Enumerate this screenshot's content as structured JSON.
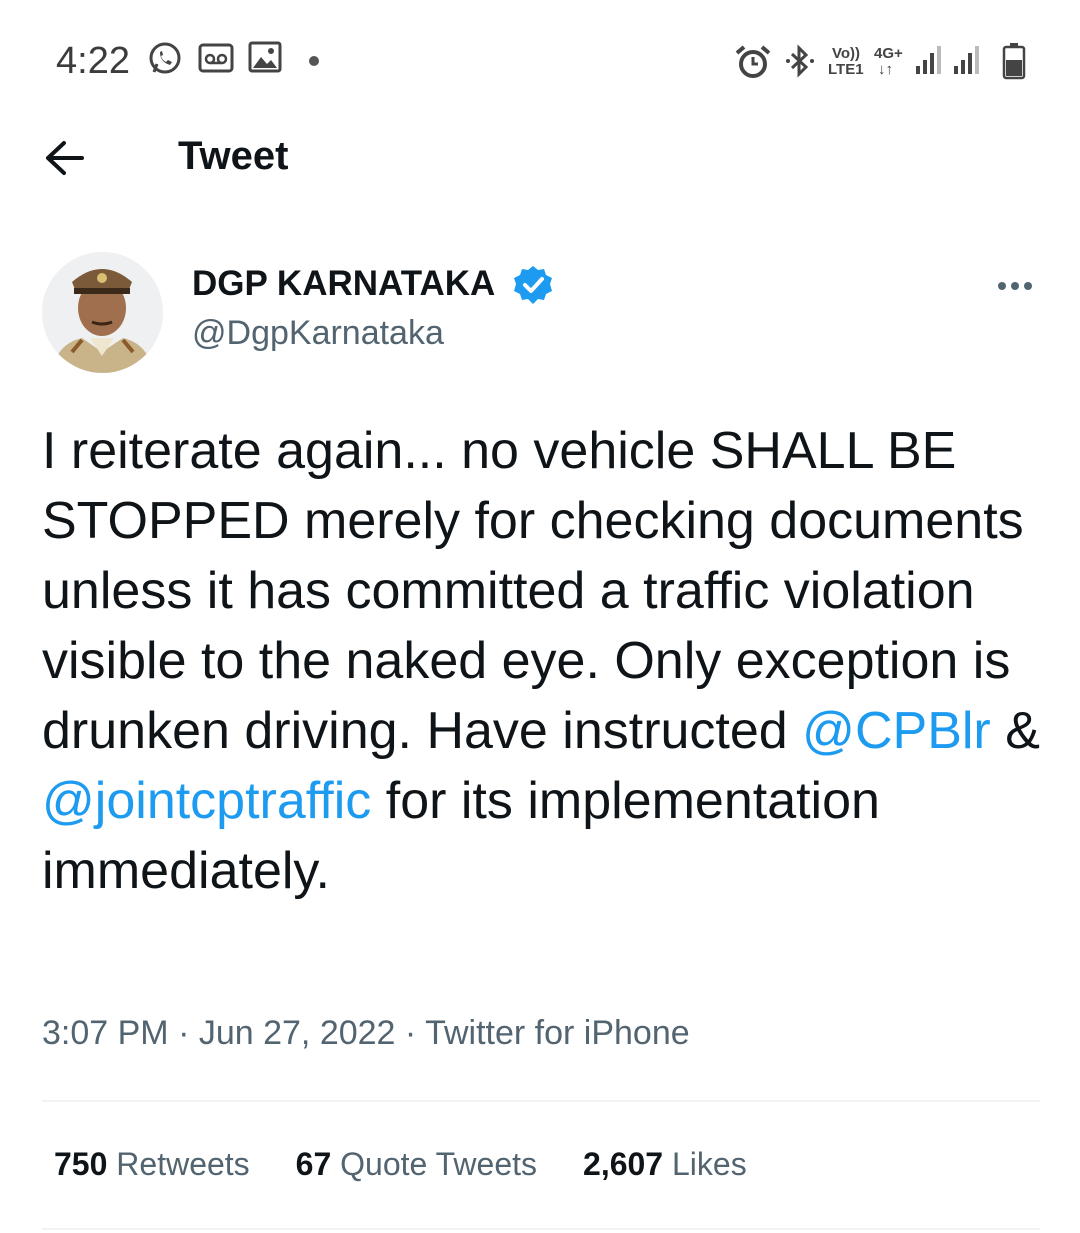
{
  "status_bar": {
    "time": "4:22",
    "volte_line1": "Vo))",
    "volte_line2": "LTE1",
    "network_line1": "4G+",
    "network_line2": "↓↑",
    "icons": [
      "whatsapp-icon",
      "voicemail-icon",
      "gallery-icon",
      "alarm-icon",
      "bluetooth-icon",
      "signal-icon",
      "battery-icon"
    ]
  },
  "header": {
    "back_icon": "arrow-left-icon",
    "title": "Tweet"
  },
  "author": {
    "name": "DGP KARNATAKA",
    "handle": "@DgpKarnataka",
    "verified_icon": "verified-badge-icon",
    "more_icon": "more-dots-icon"
  },
  "tweet": {
    "text_before": "I reiterate again... no vehicle SHALL BE STOPPED merely for checking documents unless it has committed a traffic violation visible to the naked eye. Only exception is drunken driving. Have instructed ",
    "mention1": "@CPBlr",
    "text_middle": " & ",
    "mention2": "@jointcptraffic",
    "text_after": " for its implementation immediately."
  },
  "meta": {
    "time": "3:07 PM",
    "sep": " · ",
    "date": "Jun 27, 2022",
    "source": "Twitter for iPhone"
  },
  "stats": {
    "retweets_count": "750",
    "retweets_label": "Retweets",
    "quotes_count": "67",
    "quotes_label": "Quote Tweets",
    "likes_count": "2,607",
    "likes_label": "Likes"
  },
  "colors": {
    "accent": "#1d9bf0",
    "text": "#0f1419",
    "secondary": "#536471",
    "divider": "#eff3f4"
  }
}
